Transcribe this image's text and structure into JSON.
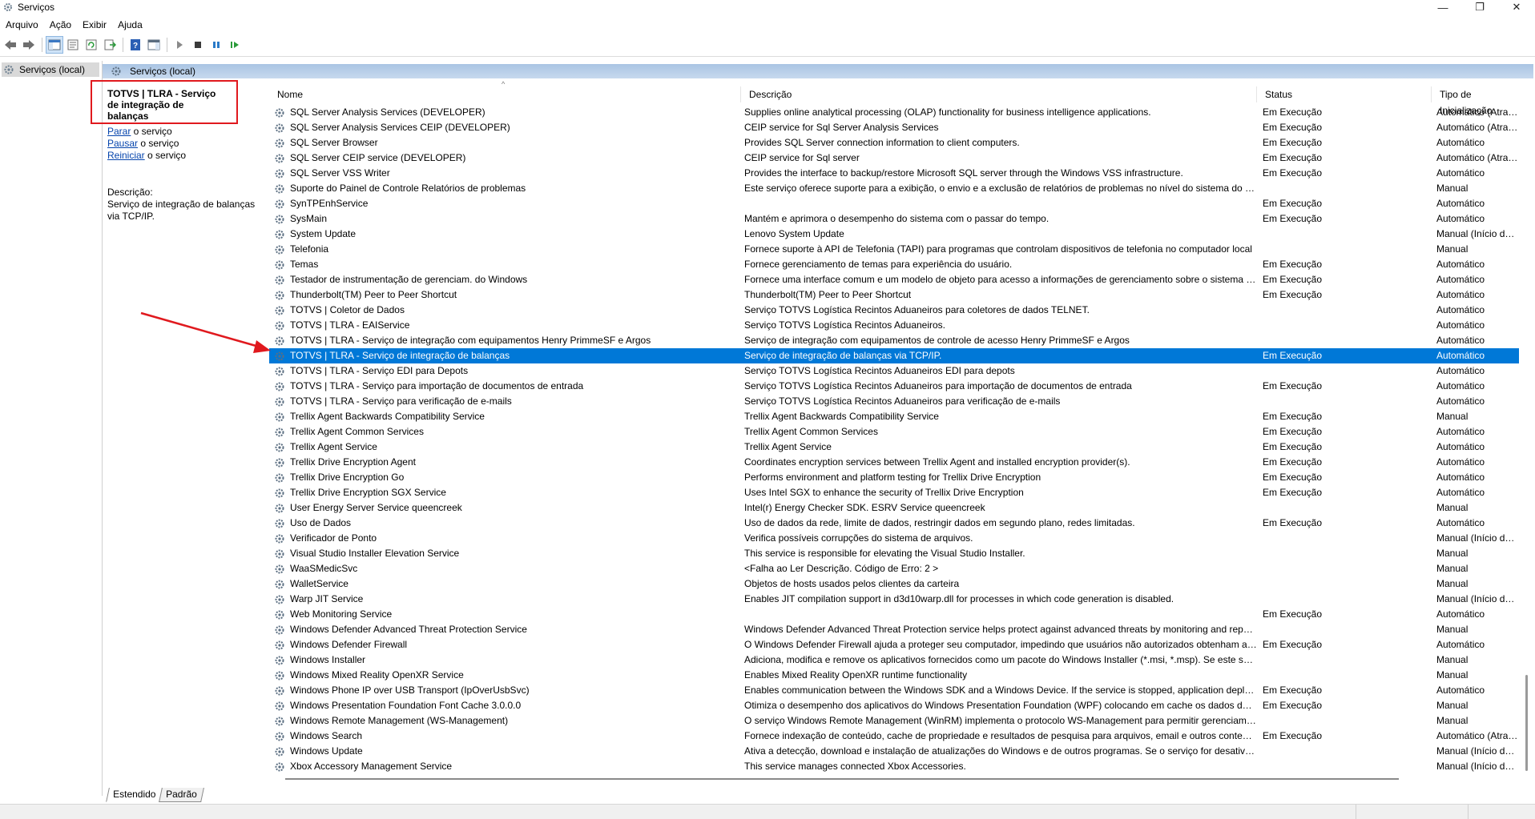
{
  "window": {
    "title": "Serviços",
    "minimize": "—",
    "maximize": "❐",
    "close": "✕"
  },
  "menu": [
    "Arquivo",
    "Ação",
    "Exibir",
    "Ajuda"
  ],
  "tree": {
    "item": "Serviços (local)"
  },
  "panel_header": "Serviços (local)",
  "selected_service": {
    "title": "TOTVS | TLRA - Serviço de integração de balanças",
    "actions": [
      {
        "link": "Parar",
        "rest": " o serviço"
      },
      {
        "link": "Pausar",
        "rest": " o serviço"
      },
      {
        "link": "Reiniciar",
        "rest": " o serviço"
      }
    ],
    "description_label": "Descrição:",
    "description": "Serviço de integração de balanças via TCP/IP."
  },
  "columns": {
    "name": "Nome",
    "description": "Descrição",
    "status": "Status",
    "startup": "Tipo de Inicialização"
  },
  "services": [
    {
      "name": "SQL Server Analysis Services (DEVELOPER)",
      "desc": "Supplies online analytical processing (OLAP) functionality for business intelligence applications.",
      "status": "Em Execução",
      "startup": "Automático (Atrasado)"
    },
    {
      "name": "SQL Server Analysis Services CEIP (DEVELOPER)",
      "desc": "CEIP service for Sql Server Analysis Services",
      "status": "Em Execução",
      "startup": "Automático (Atrasado)"
    },
    {
      "name": "SQL Server Browser",
      "desc": "Provides SQL Server connection information to client computers.",
      "status": "Em Execução",
      "startup": "Automático"
    },
    {
      "name": "SQL Server CEIP service (DEVELOPER)",
      "desc": "CEIP service for Sql server",
      "status": "Em Execução",
      "startup": "Automático (Atrasado)"
    },
    {
      "name": "SQL Server VSS Writer",
      "desc": "Provides the interface to backup/restore Microsoft SQL server through the Windows VSS infrastructure.",
      "status": "Em Execução",
      "startup": "Automático"
    },
    {
      "name": "Suporte do Painel de Controle Relatórios de problemas",
      "desc": "Este serviço oferece suporte para a exibição, o envio e a exclusão de relatórios de problemas no nível do sistema do painel de controle",
      "status": "",
      "startup": "Manual"
    },
    {
      "name": "SynTPEnhService",
      "desc": "",
      "status": "Em Execução",
      "startup": "Automático"
    },
    {
      "name": "SysMain",
      "desc": "Mantém e aprimora o desempenho do sistema com o passar do tempo.",
      "status": "Em Execução",
      "startup": "Automático"
    },
    {
      "name": "System Update",
      "desc": "Lenovo System Update",
      "status": "",
      "startup": "Manual (Início do Gatilho)"
    },
    {
      "name": "Telefonia",
      "desc": "Fornece suporte à API de Telefonia (TAPI) para programas que controlam dispositivos de telefonia no computador local",
      "status": "",
      "startup": "Manual"
    },
    {
      "name": "Temas",
      "desc": "Fornece gerenciamento de temas para experiência do usuário.",
      "status": "Em Execução",
      "startup": "Automático"
    },
    {
      "name": "Testador de instrumentação de gerenciam. do Windows",
      "desc": "Fornece uma interface comum e um modelo de objeto para acesso a informações de gerenciamento sobre o sistema operacional",
      "status": "Em Execução",
      "startup": "Automático"
    },
    {
      "name": "Thunderbolt(TM) Peer to Peer Shortcut",
      "desc": "Thunderbolt(TM) Peer to Peer Shortcut",
      "status": "Em Execução",
      "startup": "Automático"
    },
    {
      "name": "TOTVS | Coletor de Dados",
      "desc": "Serviço TOTVS Logística Recintos Aduaneiros para coletores de dados TELNET.",
      "status": "",
      "startup": "Automático"
    },
    {
      "name": "TOTVS | TLRA - EAIService",
      "desc": "Serviço TOTVS Logística Recintos Aduaneiros.",
      "status": "",
      "startup": "Automático"
    },
    {
      "name": "TOTVS | TLRA - Serviço de integração com equipamentos Henry PrimmeSF e Argos",
      "desc": "Serviço de integração com equipamentos de controle de acesso Henry PrimmeSF e Argos",
      "status": "",
      "startup": "Automático"
    },
    {
      "name": "TOTVS | TLRA - Serviço de integração de balanças",
      "desc": "Serviço de integração de balanças via TCP/IP.",
      "status": "Em Execução",
      "startup": "Automático",
      "selected": true
    },
    {
      "name": "TOTVS | TLRA - Serviço EDI para Depots",
      "desc": "Serviço TOTVS Logística Recintos Aduaneiros EDI para depots",
      "status": "",
      "startup": "Automático"
    },
    {
      "name": "TOTVS | TLRA - Serviço para importação de documentos de entrada",
      "desc": "Serviço TOTVS Logística Recintos Aduaneiros para importação de documentos de entrada",
      "status": "Em Execução",
      "startup": "Automático"
    },
    {
      "name": "TOTVS | TLRA - Serviço para verificação de e-mails",
      "desc": "Serviço TOTVS Logística Recintos Aduaneiros para verificação de e-mails",
      "status": "",
      "startup": "Automático"
    },
    {
      "name": "Trellix Agent Backwards Compatibility Service",
      "desc": "Trellix Agent Backwards Compatibility Service",
      "status": "Em Execução",
      "startup": "Manual"
    },
    {
      "name": "Trellix Agent Common Services",
      "desc": "Trellix Agent Common Services",
      "status": "Em Execução",
      "startup": "Automático"
    },
    {
      "name": "Trellix Agent Service",
      "desc": "Trellix Agent Service",
      "status": "Em Execução",
      "startup": "Automático"
    },
    {
      "name": "Trellix Drive Encryption Agent",
      "desc": "Coordinates encryption services between Trellix Agent and installed encryption provider(s).",
      "status": "Em Execução",
      "startup": "Automático"
    },
    {
      "name": "Trellix Drive Encryption Go",
      "desc": "Performs environment and platform testing for Trellix Drive Encryption",
      "status": "Em Execução",
      "startup": "Automático"
    },
    {
      "name": "Trellix Drive Encryption SGX Service",
      "desc": "Uses Intel SGX to enhance the security of Trellix Drive Encryption",
      "status": "Em Execução",
      "startup": "Automático"
    },
    {
      "name": "User Energy Server Service queencreek",
      "desc": "Intel(r) Energy Checker SDK. ESRV Service queencreek",
      "status": "",
      "startup": "Manual"
    },
    {
      "name": "Uso de Dados",
      "desc": "Uso de dados da rede, limite de dados, restringir dados em segundo plano, redes limitadas.",
      "status": "Em Execução",
      "startup": "Automático"
    },
    {
      "name": "Verificador de Ponto",
      "desc": "Verifica possíveis corrupções do sistema de arquivos.",
      "status": "",
      "startup": "Manual (Início do Gatilho)"
    },
    {
      "name": "Visual Studio Installer Elevation Service",
      "desc": "This service is responsible for elevating the Visual Studio Installer.",
      "status": "",
      "startup": "Manual"
    },
    {
      "name": "WaaSMedicSvc",
      "desc": "<Falha ao Ler Descrição. Código de Erro: 2 >",
      "status": "",
      "startup": "Manual"
    },
    {
      "name": "WalletService",
      "desc": "Objetos de hosts usados pelos clientes da carteira",
      "status": "",
      "startup": "Manual"
    },
    {
      "name": "Warp JIT Service",
      "desc": "Enables JIT compilation support in d3d10warp.dll for processes in which code generation is disabled.",
      "status": "",
      "startup": "Manual (Início do Gatilho)"
    },
    {
      "name": "Web Monitoring Service",
      "desc": "",
      "status": "Em Execução",
      "startup": "Automático"
    },
    {
      "name": "Windows Defender Advanced Threat Protection Service",
      "desc": "Windows Defender Advanced Threat Protection service helps protect against advanced threats by monitoring and reporting security events",
      "status": "",
      "startup": "Manual"
    },
    {
      "name": "Windows Defender Firewall",
      "desc": "O Windows Defender Firewall ajuda a proteger seu computador, impedindo que usuários não autorizados obtenham acesso",
      "status": "Em Execução",
      "startup": "Automático"
    },
    {
      "name": "Windows Installer",
      "desc": "Adiciona, modifica e remove os aplicativos fornecidos como um pacote do Windows Installer (*.msi, *.msp). Se este serviço for desabilitado",
      "status": "",
      "startup": "Manual"
    },
    {
      "name": "Windows Mixed Reality OpenXR Service",
      "desc": "Enables Mixed Reality OpenXR runtime functionality",
      "status": "",
      "startup": "Manual"
    },
    {
      "name": "Windows Phone IP over USB Transport (IpOverUsbSvc)",
      "desc": "Enables communication between the Windows SDK and a Windows Device. If the service is stopped, application deployment",
      "status": "Em Execução",
      "startup": "Automático"
    },
    {
      "name": "Windows Presentation Foundation Font Cache 3.0.0.0",
      "desc": "Otimiza o desempenho dos aplicativos do Windows Presentation Foundation (WPF) colocando em cache os dados de fonte",
      "status": "Em Execução",
      "startup": "Manual"
    },
    {
      "name": "Windows Remote Management (WS-Management)",
      "desc": "O serviço Windows Remote Management (WinRM) implementa o protocolo WS-Management para permitir gerenciamento remoto",
      "status": "",
      "startup": "Manual"
    },
    {
      "name": "Windows Search",
      "desc": "Fornece indexação de conteúdo, cache de propriedade e resultados de pesquisa para arquivos, email e outros conteúdos",
      "status": "Em Execução",
      "startup": "Automático (Atrasado)"
    },
    {
      "name": "Windows Update",
      "desc": "Ativa a detecção, download e instalação de atualizações do Windows e de outros programas. Se o serviço for desativado",
      "status": "",
      "startup": "Manual (Início do Gatilho)"
    },
    {
      "name": "Xbox Accessory Management Service",
      "desc": "This service manages connected Xbox Accessories.",
      "status": "",
      "startup": "Manual (Início do Gatilho)"
    }
  ],
  "tabs": {
    "extended": "Estendido",
    "standard": "Padrão"
  },
  "colors": {
    "selection": "#0078d7",
    "annotation": "#e0191e",
    "header_gradient": "#a9c4e3"
  }
}
